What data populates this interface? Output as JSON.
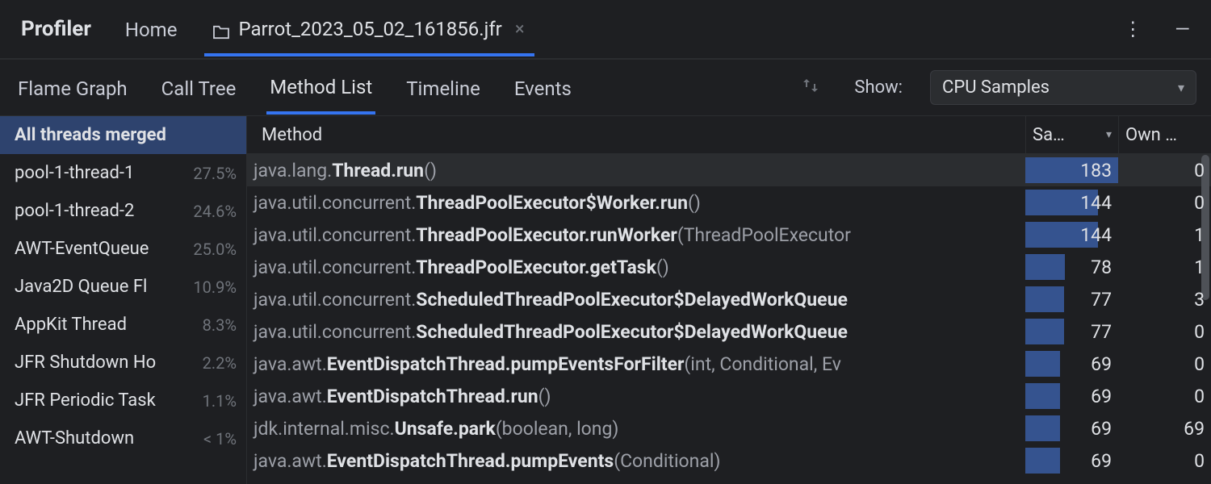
{
  "header": {
    "title": "Profiler",
    "home_tab": "Home",
    "file_tab": "Parrot_2023_05_02_161856.jfr"
  },
  "subtabs": {
    "items": [
      "Flame Graph",
      "Call Tree",
      "Method List",
      "Timeline",
      "Events"
    ],
    "active_index": 2,
    "show_label": "Show:",
    "dropdown_value": "CPU Samples"
  },
  "sidebar": {
    "items": [
      {
        "name": "All threads merged",
        "pct": ""
      },
      {
        "name": "pool-1-thread-1",
        "pct": "27.5%"
      },
      {
        "name": "pool-1-thread-2",
        "pct": "24.6%"
      },
      {
        "name": "AWT-EventQueue",
        "pct": "25.0%"
      },
      {
        "name": "Java2D Queue Fl",
        "pct": "10.9%"
      },
      {
        "name": "AppKit Thread",
        "pct": "8.3%"
      },
      {
        "name": "JFR Shutdown Ho",
        "pct": "2.2%"
      },
      {
        "name": "JFR Periodic Task",
        "pct": "1.1%"
      },
      {
        "name": "AWT-Shutdown",
        "pct": "< 1%"
      }
    ],
    "selected_index": 0
  },
  "table": {
    "headers": {
      "method": "Method",
      "samples": "Sa…",
      "own": "Own …"
    },
    "max_samples": 183,
    "selected_index": 0,
    "rows": [
      {
        "pkg": "java.lang.",
        "sig_bold": "Thread.run",
        "sig_rest": "()",
        "samples": 183,
        "own": 0
      },
      {
        "pkg": "java.util.concurrent.",
        "sig_bold": "ThreadPoolExecutor$Worker.run",
        "sig_rest": "()",
        "samples": 144,
        "own": 0
      },
      {
        "pkg": "java.util.concurrent.",
        "sig_bold": "ThreadPoolExecutor.runWorker",
        "sig_rest": "(ThreadPoolExecutor",
        "samples": 144,
        "own": 1
      },
      {
        "pkg": "java.util.concurrent.",
        "sig_bold": "ThreadPoolExecutor.getTask",
        "sig_rest": "()",
        "samples": 78,
        "own": 1
      },
      {
        "pkg": "java.util.concurrent.",
        "sig_bold": "ScheduledThreadPoolExecutor$DelayedWorkQueue",
        "sig_rest": "",
        "samples": 77,
        "own": 3
      },
      {
        "pkg": "java.util.concurrent.",
        "sig_bold": "ScheduledThreadPoolExecutor$DelayedWorkQueue",
        "sig_rest": "",
        "samples": 77,
        "own": 0
      },
      {
        "pkg": "java.awt.",
        "sig_bold": "EventDispatchThread.pumpEventsForFilter",
        "sig_rest": "(int, Conditional, Ev",
        "samples": 69,
        "own": 0
      },
      {
        "pkg": "java.awt.",
        "sig_bold": "EventDispatchThread.run",
        "sig_rest": "()",
        "samples": 69,
        "own": 0
      },
      {
        "pkg": "jdk.internal.misc.",
        "sig_bold": "Unsafe.park",
        "sig_rest": "(boolean, long)",
        "samples": 69,
        "own": 69
      },
      {
        "pkg": "java.awt.",
        "sig_bold": "EventDispatchThread.pumpEvents",
        "sig_rest": "(Conditional)",
        "samples": 69,
        "own": 0
      }
    ]
  }
}
